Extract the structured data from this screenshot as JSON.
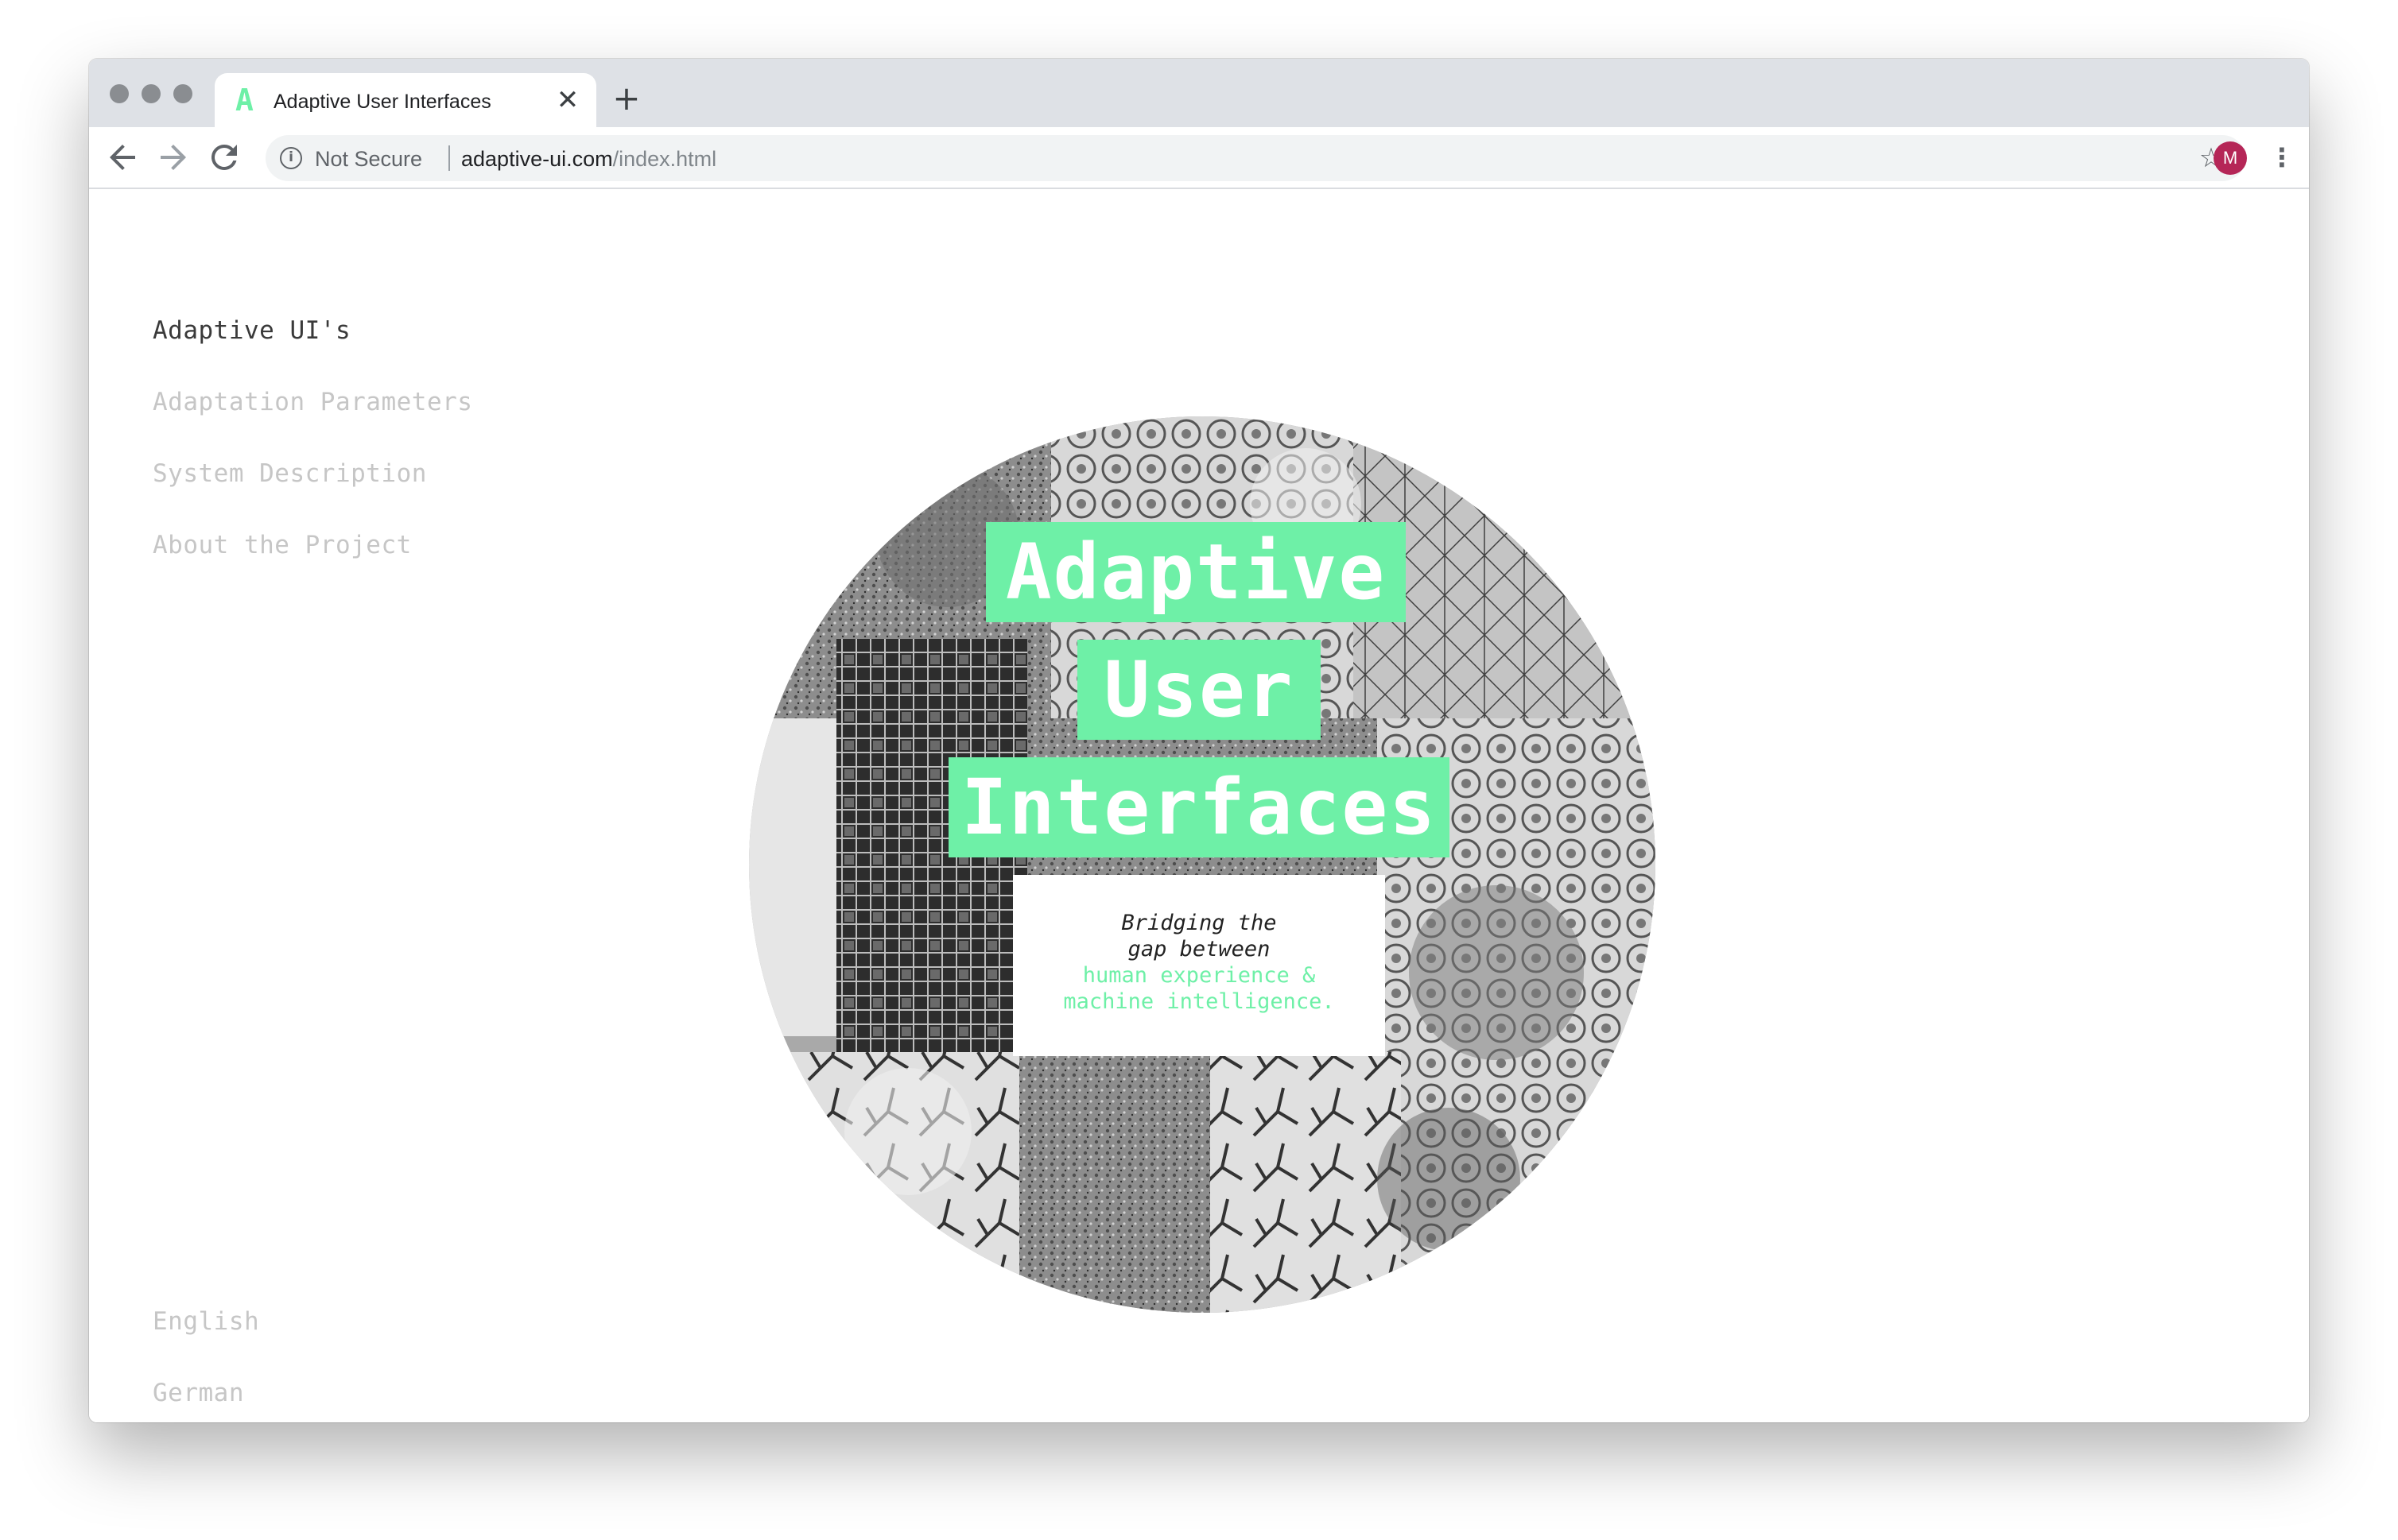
{
  "browser": {
    "tab_title": "Adaptive User Interfaces",
    "tab_favicon": "A",
    "close_tab_glyph": "✕",
    "new_tab_glyph": "+",
    "security_label": "Not Secure",
    "url_host": "adaptive-ui.com",
    "url_path": "/index.html",
    "profile_initial": "M",
    "accent_color": "#6ef0a7",
    "avatar_color": "#b52657",
    "icons": [
      "back-arrow-icon",
      "forward-arrow-icon",
      "reload-icon",
      "info-icon",
      "star-icon",
      "kebab-menu-icon"
    ]
  },
  "sidebar": {
    "items": [
      {
        "label": "Adaptive UI's",
        "active": true
      },
      {
        "label": "Adaptation Parameters",
        "active": false
      },
      {
        "label": "System Description",
        "active": false
      },
      {
        "label": "About the Project",
        "active": false
      }
    ]
  },
  "languages": {
    "items": [
      {
        "label": "English"
      },
      {
        "label": "German"
      }
    ]
  },
  "hero": {
    "title_lines": [
      "Adaptive",
      "User",
      "Interfaces"
    ],
    "subtitle_lines": [
      "Bridging the",
      "gap between"
    ],
    "highlight_lines": [
      "human experience &",
      "machine intelligence."
    ],
    "title_bg_color": "#6ef0a7",
    "highlight_color": "#6ef0a7"
  }
}
